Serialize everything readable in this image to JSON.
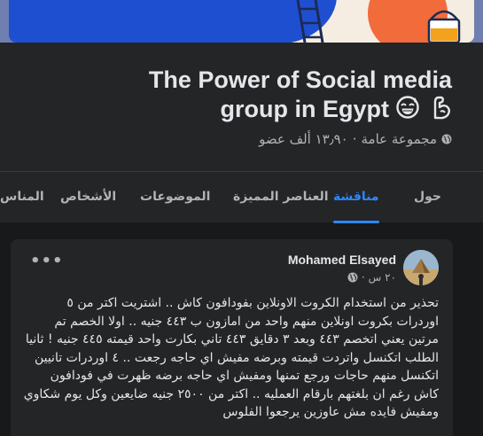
{
  "group": {
    "name": "The Power of Social media group in Egypt",
    "privacy": "مجموعة عامة",
    "members": "١٣٫٩٠ ألف عضو",
    "separator": "·",
    "emojis": [
      "grinning-sweat-face",
      "flexed-biceps"
    ]
  },
  "tabs": [
    {
      "label": "حول",
      "active": false
    },
    {
      "label": "مناقشة",
      "active": true
    },
    {
      "label": "العناصر المميزة",
      "active": false
    },
    {
      "label": "الموضوعات",
      "active": false
    },
    {
      "label": "الأشخاص",
      "active": false
    },
    {
      "label": "المناس",
      "active": false
    }
  ],
  "post": {
    "author": "Mohamed Elsayed",
    "time": "٢٠ س",
    "separator": "·",
    "more_label": "•••",
    "text": "تحذير من استخدام الكروت الاونلاين بفودافون كاش .. اشتريت اكتر من ٥ اوردرات بكروت اونلاين منهم واحد من امازون ب ٤٤٣ جنيه .. اولا الخصم تم مرتين يعني اتخصم ٤٤٣ وبعد ٣ دقايق ٤٤٣ تاني بكارت واحد قيمته ٤٤٥ جنيه ! ثانيا الطلب اتكنسل واتردت قيمته وبرضه مفيش اي حاجه رجعت .. ٤ اوردرات تانيين اتكنسل منهم حاجات ورجع تمنها ومفيش اي حاجه برضه ظهرت في فودافون كاش رغم ان بلغتهم بارقام العمليه .. اكتر من ٢٥٠٠ جنيه ضايعين وكل يوم شكاوي ومفيش فايده مش عاوزين يرجعوا الفلوس"
  },
  "colors": {
    "background": "#18191a",
    "surface": "#242526",
    "accent": "#2d88ff",
    "text_primary": "#e4e6eb",
    "text_secondary": "#b0b3b8"
  }
}
